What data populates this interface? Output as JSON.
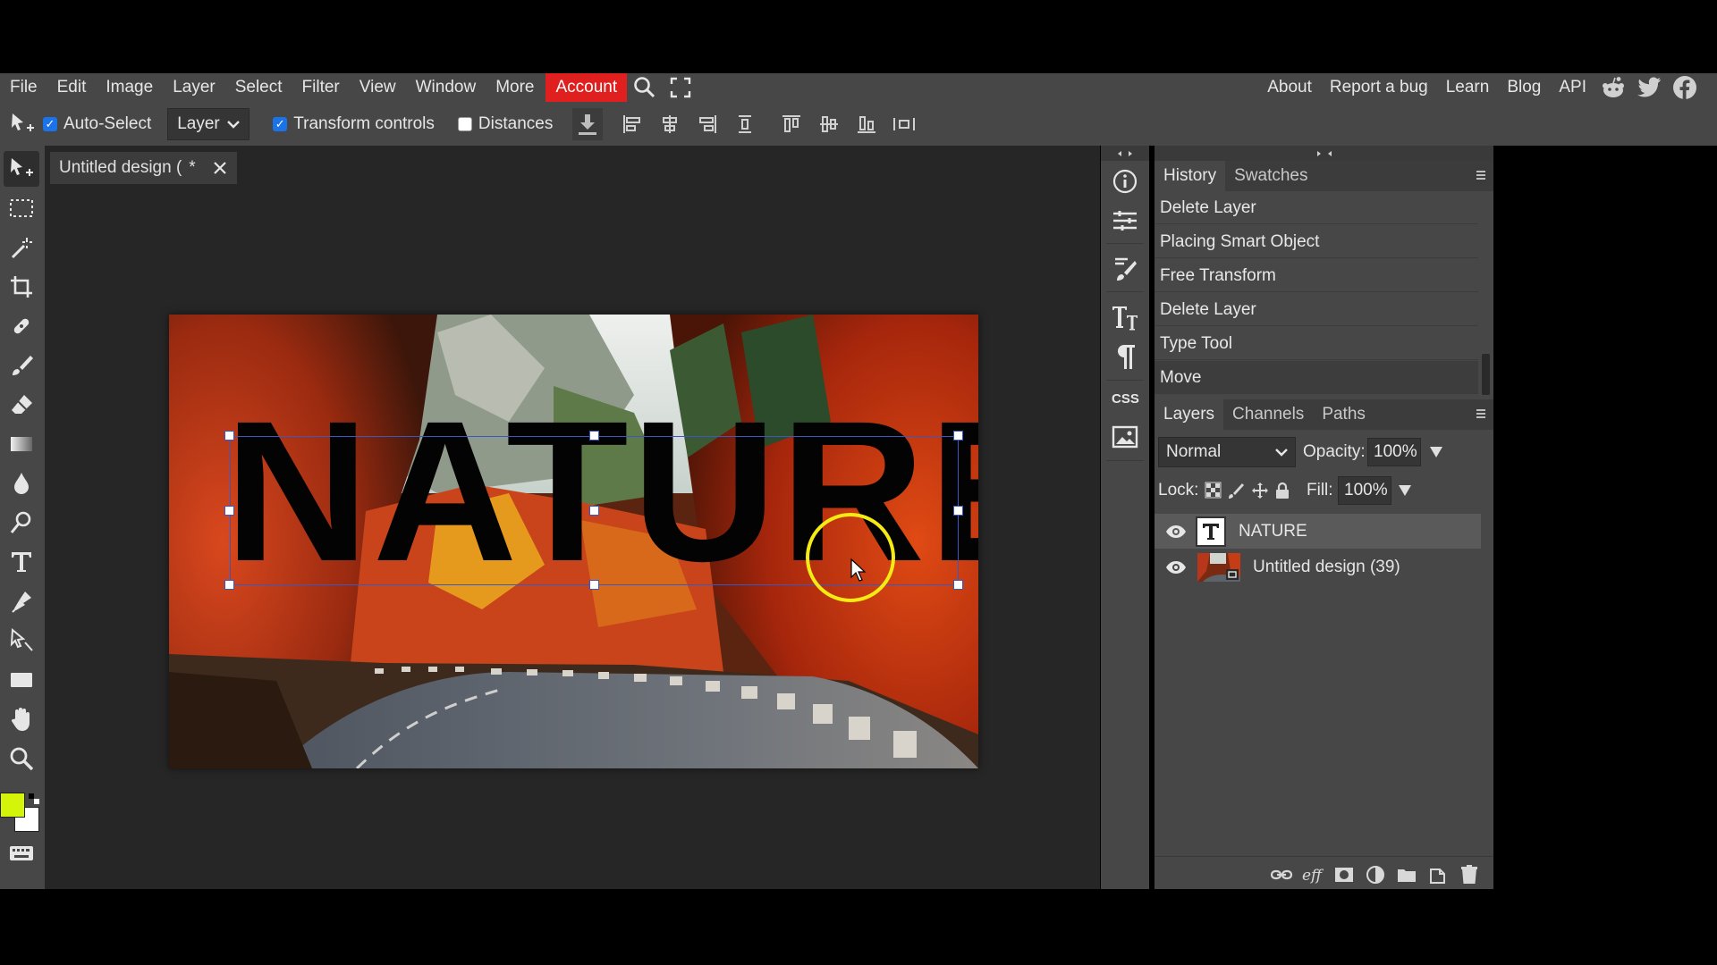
{
  "menubar": {
    "items": [
      "File",
      "Edit",
      "Image",
      "Layer",
      "Select",
      "Filter",
      "View",
      "Window",
      "More"
    ],
    "account": "Account",
    "right_items": [
      "About",
      "Report a bug",
      "Learn",
      "Blog",
      "API"
    ],
    "icons": [
      "search-icon",
      "fullscreen-icon",
      "reddit-icon",
      "twitter-icon",
      "facebook-icon"
    ],
    "account_color": "#e0201f"
  },
  "options": {
    "auto_select_label": "Auto-Select",
    "auto_select_checked": true,
    "layer_select_value": "Layer",
    "transform_controls_label": "Transform controls",
    "transform_controls_checked": true,
    "distances_label": "Distances",
    "distances_checked": false
  },
  "document": {
    "tab_title": "Untitled design (",
    "modified_marker": "*",
    "canvas_text": "NATURE"
  },
  "history": {
    "tabs": [
      "History",
      "Swatches"
    ],
    "items": [
      "Delete Layer",
      "Placing Smart Object",
      "Free Transform",
      "Delete Layer",
      "Type Tool",
      "Move"
    ]
  },
  "layers": {
    "tabs": [
      "Layers",
      "Channels",
      "Paths"
    ],
    "blend_mode": "Normal",
    "opacity_label": "Opacity:",
    "opacity_value": "100%",
    "lock_label": "Lock:",
    "fill_label": "Fill:",
    "fill_value": "100%",
    "items": [
      {
        "name": "NATURE",
        "type": "text",
        "selected": true
      },
      {
        "name": "Untitled design (39)",
        "type": "image",
        "selected": false
      }
    ]
  },
  "colors": {
    "foreground": "#d4f50a",
    "background": "#ffffff",
    "highlight_ring": "#f4ea14"
  }
}
